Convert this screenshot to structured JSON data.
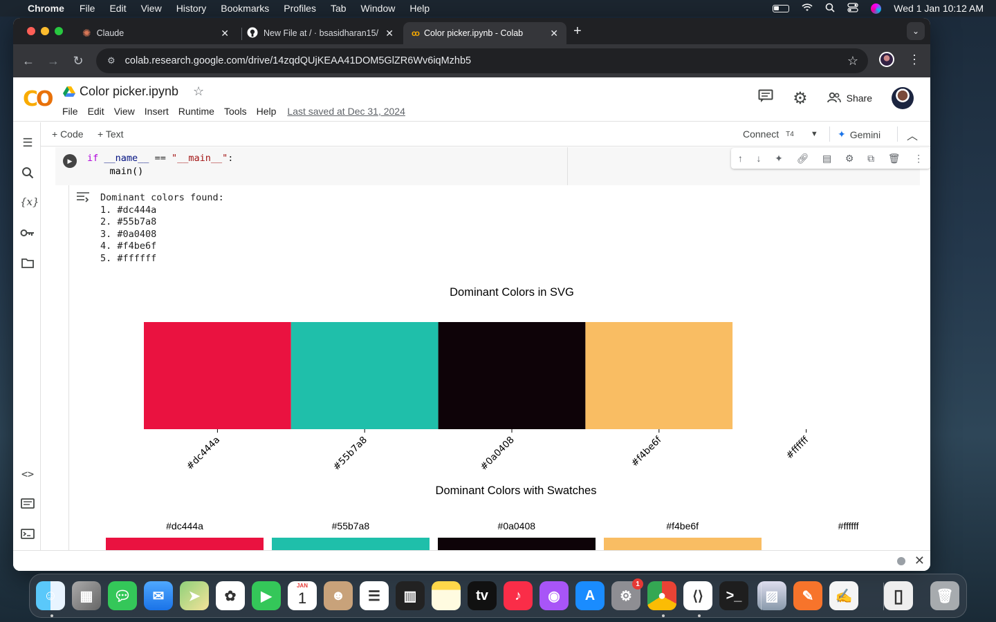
{
  "menubar": {
    "app": "Chrome",
    "items": [
      "File",
      "Edit",
      "View",
      "History",
      "Bookmarks",
      "Profiles",
      "Tab",
      "Window",
      "Help"
    ],
    "clock": "Wed 1 Jan  10:12 AM"
  },
  "tabs": [
    {
      "label": "Claude",
      "icon": "claude-icon"
    },
    {
      "label": "New File at / · bsasidharan15/",
      "icon": "github-icon"
    },
    {
      "label": "Color picker.ipynb - Colab",
      "icon": "colab-icon",
      "active": true
    }
  ],
  "address": {
    "url": "colab.research.google.com/drive/14zqdQUjKEAA41DOM5GlZR6Wv6iqMzhb5"
  },
  "colab": {
    "title": "Color picker.ipynb",
    "menu": [
      "File",
      "Edit",
      "View",
      "Insert",
      "Runtime",
      "Tools",
      "Help"
    ],
    "last_saved": "Last saved at Dec 31, 2024",
    "share_label": "Share",
    "add_code": "+ Code",
    "add_text": "+ Text",
    "connect": "Connect",
    "runtime": "T4",
    "gemini": "Gemini"
  },
  "cell": {
    "code_line1_kw": "if",
    "code_line1_rest_a": "__name__",
    "code_line1_op": " == ",
    "code_line1_str": "\"__main__\"",
    "code_line1_colon": ":",
    "code_line2": "    main()"
  },
  "output": {
    "text": "Dominant colors found:\n1. #dc444a\n2. #55b7a8\n3. #0a0408\n4. #f4be6f\n5. #ffffff"
  },
  "chart_data": [
    {
      "type": "bar",
      "title": "Dominant Colors in SVG",
      "categories": [
        "#dc444a",
        "#55b7a8",
        "#0a0408",
        "#f4be6f",
        "#ffffff"
      ],
      "values": [
        1,
        1,
        1,
        1,
        1
      ],
      "colors": [
        "#ea1240",
        "#1fbfaa",
        "#0e0308",
        "#f9bd63",
        "#ffffff"
      ],
      "ylim": [
        0,
        1
      ]
    },
    {
      "type": "bar",
      "title": "Dominant Colors with Swatches",
      "categories": [
        "#dc444a",
        "#55b7a8",
        "#0a0408",
        "#f4be6f",
        "#ffffff"
      ],
      "colors": [
        "#ea1240",
        "#1fbfaa",
        "#0e0308",
        "#f9bd63",
        "#ffffff"
      ]
    }
  ],
  "dock": [
    "Finder",
    "Launchpad",
    "Messages",
    "Mail",
    "Maps",
    "Photos",
    "FaceTime",
    "Calendar",
    "Contacts",
    "Reminders",
    "Piano",
    "Notes",
    "TV",
    "Music",
    "Podcasts",
    "App Store",
    "System Settings",
    "Chrome",
    "VS Code",
    "Terminal",
    "Preview",
    "Pages",
    "TextEdit",
    "Python",
    "Trash"
  ],
  "calendar": {
    "month": "JAN",
    "day": "1"
  },
  "settings_badge": "1"
}
